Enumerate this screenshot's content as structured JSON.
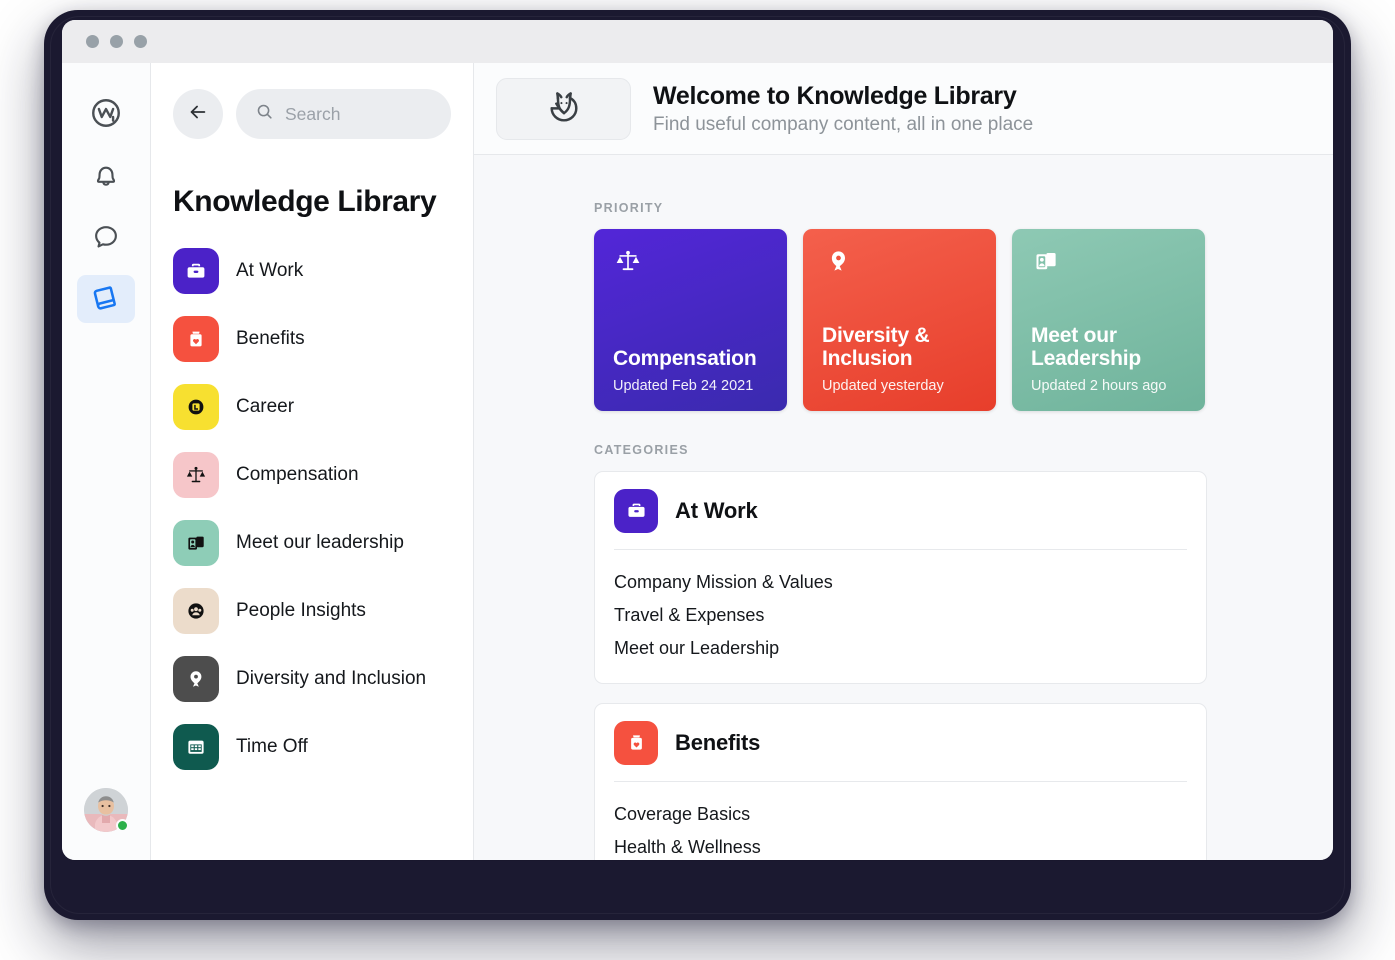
{
  "window": {
    "traffic_lights": [
      "close",
      "minimize",
      "maximize"
    ]
  },
  "rail": {
    "items": [
      {
        "name": "workplace-logo",
        "icon": "workplace-logo-icon",
        "active": false
      },
      {
        "name": "notifications",
        "icon": "bell-icon",
        "active": false
      },
      {
        "name": "chat",
        "icon": "chat-bubble-icon",
        "active": false
      },
      {
        "name": "knowledge-library",
        "icon": "book-icon",
        "active": true
      }
    ],
    "avatar": {
      "icon": "avatar",
      "status": "online",
      "status_color": "#2cb04a"
    }
  },
  "search": {
    "back_icon": "arrow-left-icon",
    "search_icon": "search-icon",
    "placeholder": "Search",
    "value": ""
  },
  "sidebar": {
    "title": "Knowledge Library",
    "items": [
      {
        "label": "At Work",
        "icon": "briefcase-icon",
        "bg": "#4b22c8",
        "fg": "#ffffff"
      },
      {
        "label": "Benefits",
        "icon": "benefits-bag-icon",
        "bg": "#f5513f",
        "fg": "#ffffff"
      },
      {
        "label": "Career",
        "icon": "career-badge-icon",
        "bg": "#f7e030",
        "fg": "#111111"
      },
      {
        "label": "Compensation",
        "icon": "scales-icon",
        "bg": "#f6c6c9",
        "fg": "#111111"
      },
      {
        "label": "Meet our leadership",
        "icon": "id-cards-icon",
        "bg": "#8ecdb7",
        "fg": "#111111"
      },
      {
        "label": "People Insights",
        "icon": "people-icon",
        "bg": "#ecdccb",
        "fg": "#111111"
      },
      {
        "label": "Diversity and Inclusion",
        "icon": "ribbon-pin-icon",
        "bg": "#4d4d4d",
        "fg": "#ffffff"
      },
      {
        "label": "Time Off",
        "icon": "calendar-icon",
        "bg": "#0f5a4f",
        "fg": "#ffffff"
      }
    ]
  },
  "header": {
    "logo_icon": "fox-head-icon",
    "title": "Welcome to Knowledge Library",
    "subtitle": "Find useful company content, all in one place"
  },
  "main": {
    "priority_label": "PRIORITY",
    "categories_label": "CATEGORIES",
    "priority_cards": [
      {
        "title": "Compensation",
        "subtitle": "Updated Feb 24 2021",
        "icon": "scales-icon",
        "color_top": "#5326d8",
        "color_bottom": "#3a2aae"
      },
      {
        "title": "Diversity & Inclusion",
        "subtitle": "Updated yesterday",
        "icon": "ribbon-pin-icon",
        "color_top": "#f4604c",
        "color_bottom": "#e73e2b"
      },
      {
        "title": "Meet our Leadership",
        "subtitle": "Updated 2 hours ago",
        "icon": "id-cards-icon",
        "color_top": "#8ec9b4",
        "color_bottom": "#6fb39b"
      }
    ],
    "categories": [
      {
        "title": "At Work",
        "icon": "briefcase-icon",
        "bg": "#4b22c8",
        "links": [
          "Company Mission & Values",
          "Travel & Expenses",
          "Meet our Leadership"
        ]
      },
      {
        "title": "Benefits",
        "icon": "benefits-bag-icon",
        "bg": "#f5513f",
        "links": [
          "Coverage Basics",
          "Health & Wellness"
        ]
      }
    ]
  }
}
